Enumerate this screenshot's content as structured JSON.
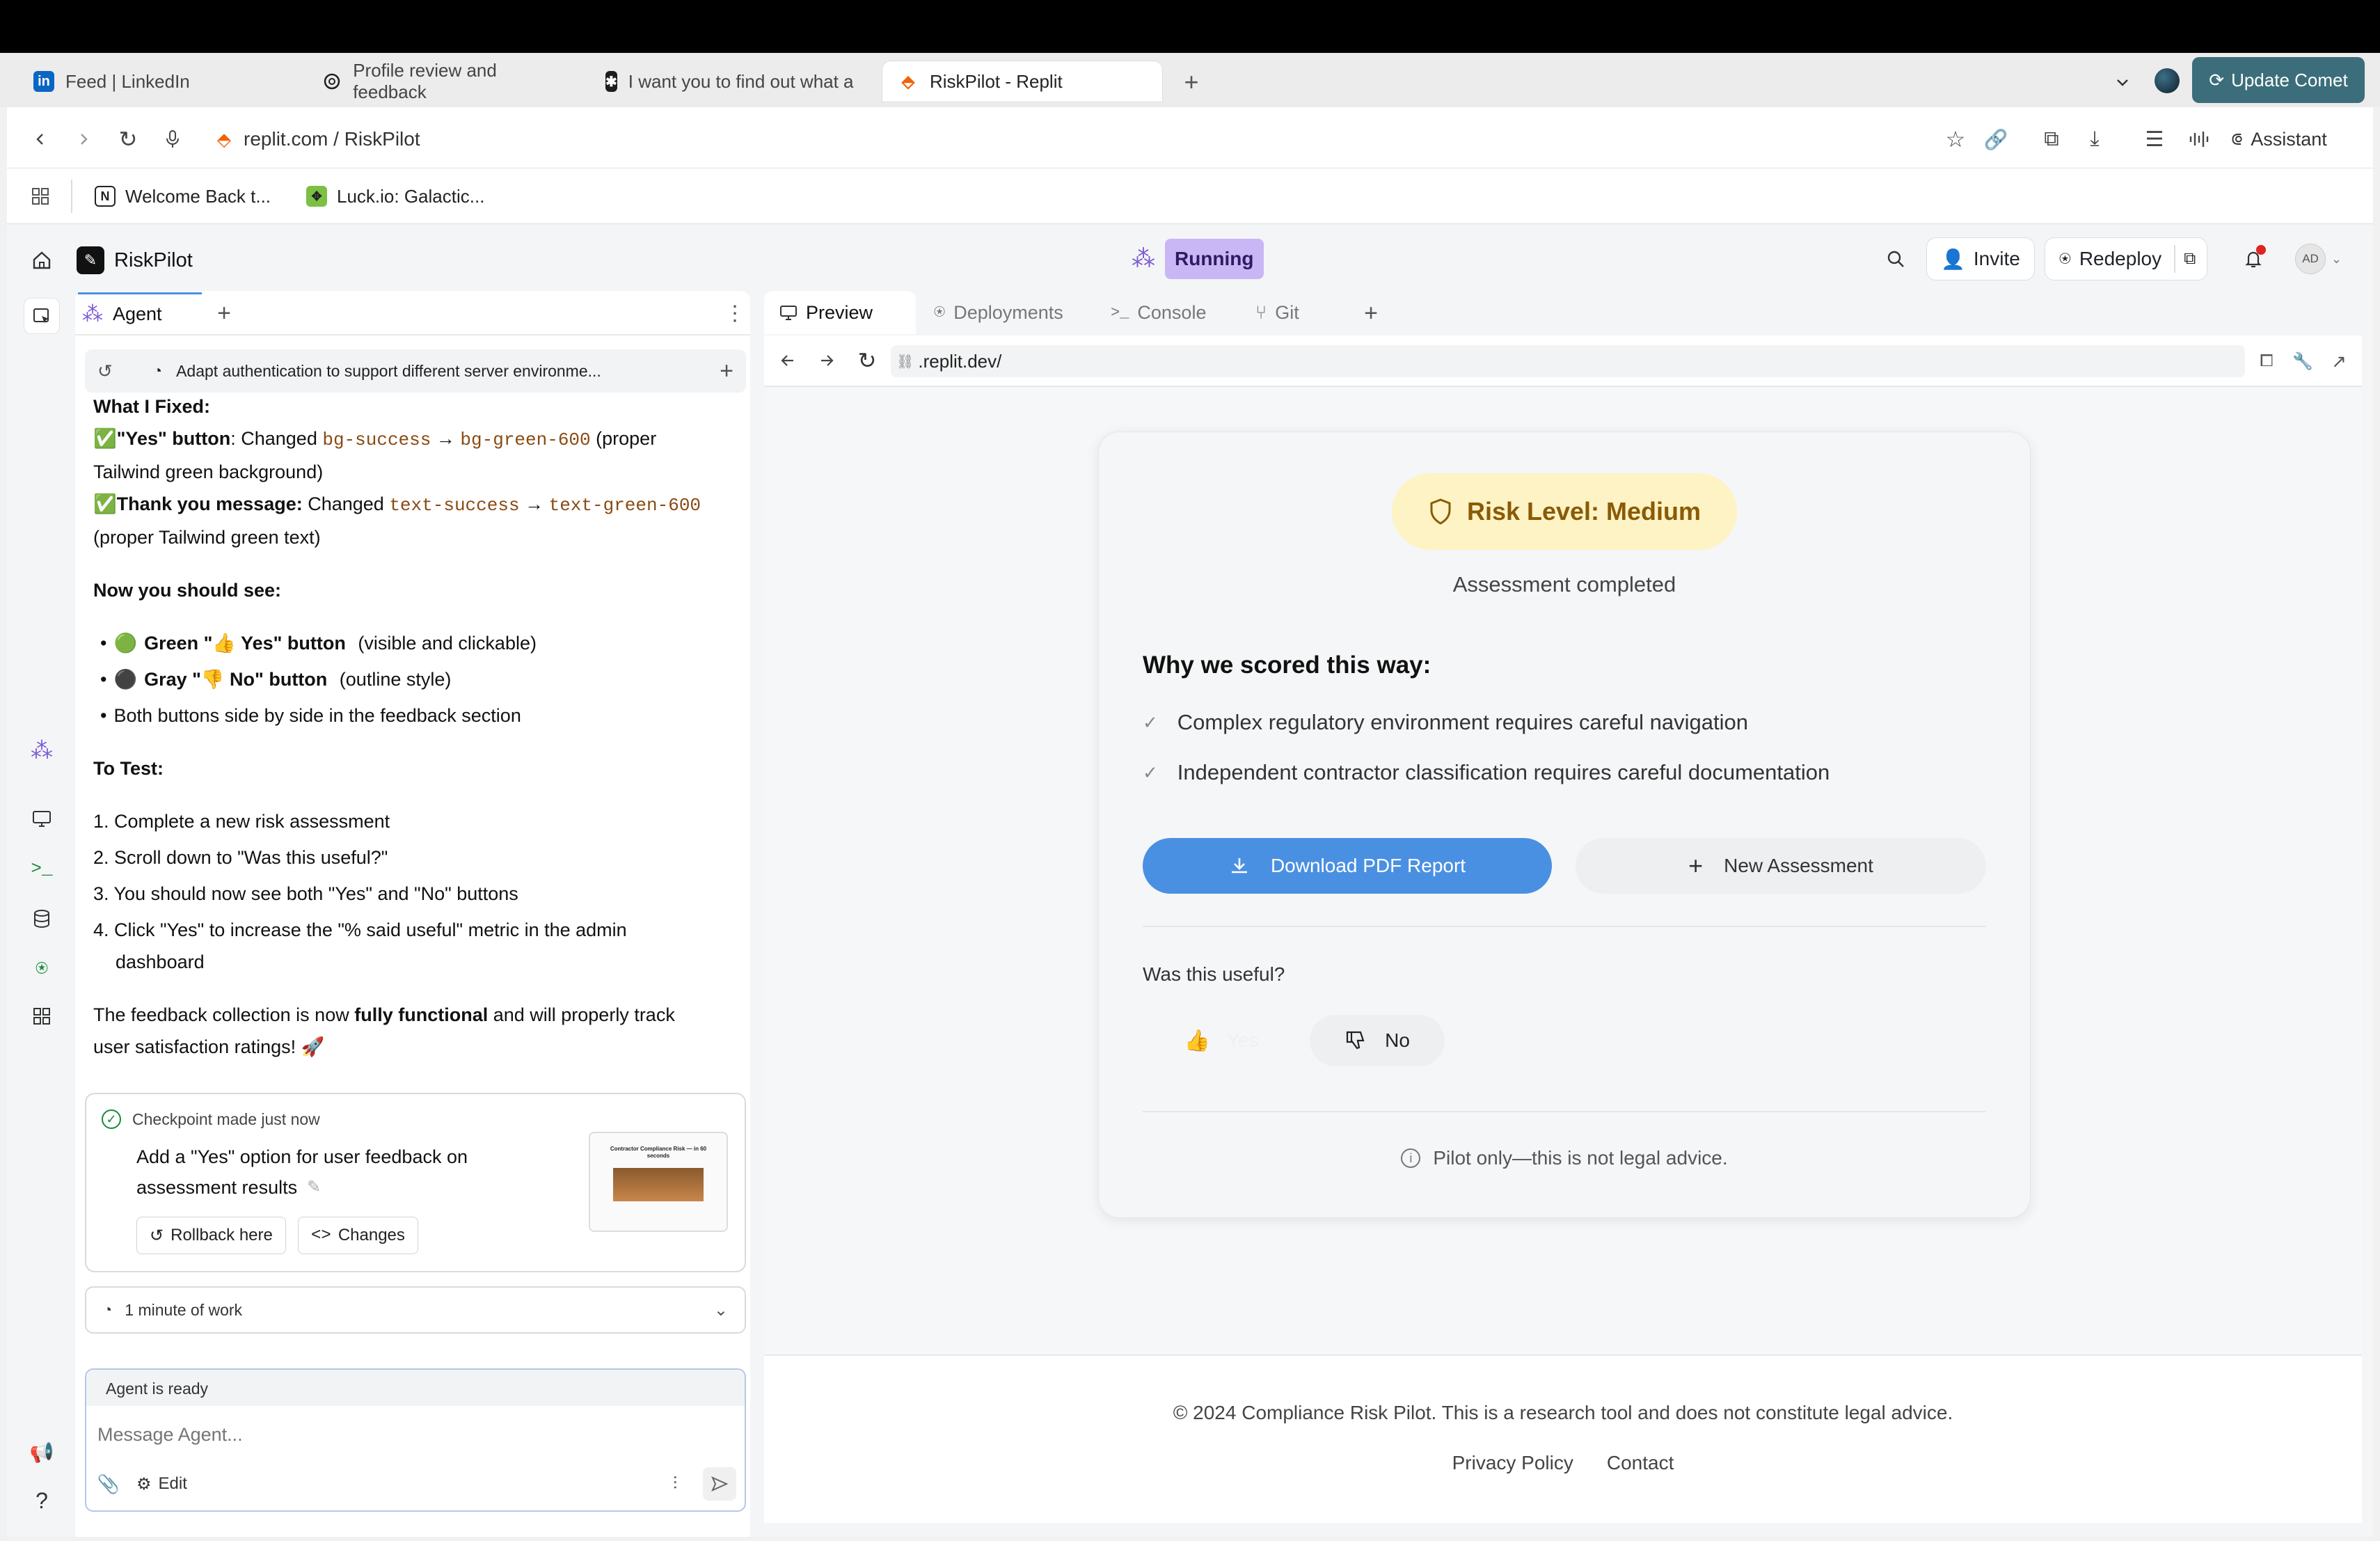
{
  "browser": {
    "tabs": [
      {
        "label": "Feed | LinkedIn",
        "icon": "linkedin-icon"
      },
      {
        "label": "Profile review and feedback",
        "icon": "openai-icon"
      },
      {
        "label": "I want you to find out what a",
        "icon": "perplexity-icon"
      },
      {
        "label": "RiskPilot - Replit",
        "icon": "replit-icon"
      }
    ],
    "update_button": "Update Comet",
    "address": "replit.com / RiskPilot",
    "assistant_label": "Assistant",
    "bookmarks": [
      "Welcome Back t...",
      "Luck.io: Galactic..."
    ]
  },
  "app": {
    "project_name": "RiskPilot",
    "status": "Running",
    "invite_label": "Invite",
    "redeploy_label": "Redeploy",
    "avatar_initials": "AD"
  },
  "agent_panel": {
    "tab_label": "Agent",
    "thread_title": "Adapt authentication to support different server environme...",
    "what_fixed_heading": "What I Fixed:",
    "fix1": {
      "check": "✅",
      "bold": "\"Yes\" button",
      "text": ": Changed ",
      "from": "bg-success",
      "arrow": "→",
      "to": "bg-green-600",
      "tail_a": " (proper",
      "tail_b": "Tailwind green background)"
    },
    "fix2": {
      "check": "✅",
      "bold": "Thank you message:",
      "text": " Changed ",
      "from": "text-success",
      "arrow": "→",
      "to": "text-green-600",
      "tail": "(proper Tailwind green text)"
    },
    "now_heading": "Now you should see:",
    "bullets": [
      {
        "emoji": "🟢",
        "bold": "Green \"👍 Yes\" button",
        "text": " (visible and clickable)"
      },
      {
        "emoji": "⚫",
        "bold": "Gray \"👎 No\" button",
        "text": " (outline style)"
      },
      {
        "emoji": "",
        "bold": "",
        "text": "Both buttons side by side in the feedback section"
      }
    ],
    "test_heading": "To Test:",
    "steps": [
      "1. Complete a new risk assessment",
      "2. Scroll down to \"Was this useful?\"",
      "3. You should now see both \"Yes\" and \"No\" buttons",
      "4. Click \"Yes\" to increase the \"% said useful\" metric in the admin"
    ],
    "step4_cont": "dashboard",
    "closing_a": "The feedback collection is now ",
    "closing_bold": "fully functional",
    "closing_b": " and will properly track",
    "closing_c": "user satisfaction ratings! 🚀",
    "checkpoint": {
      "label": "Checkpoint made just now",
      "title_a": "Add a \"Yes\" option for user feedback on",
      "title_b": "assessment results",
      "rollback": "Rollback here",
      "changes": "Changes",
      "thumb_title": "Contractor Compliance Risk — in 60 seconds"
    },
    "work_time": "1 minute of work",
    "agent_status": "Agent is ready",
    "input_placeholder": "Message Agent...",
    "edit_label": "Edit"
  },
  "preview_panel": {
    "tabs": [
      "Preview",
      "Deployments",
      "Console",
      "Git"
    ],
    "url": ".replit.dev/",
    "risk_badge": "Risk Level: Medium",
    "assessment_status": "Assessment completed",
    "why_heading": "Why we scored this way:",
    "reasons": [
      "Complex regulatory environment requires careful navigation",
      "Independent contractor classification requires careful documentation"
    ],
    "download_button": "Download PDF Report",
    "new_button": "New Assessment",
    "feedback_question": "Was this useful?",
    "yes_label": "Yes",
    "no_label": "No",
    "disclaimer": "Pilot only—this is not legal advice.",
    "footer_text": "© 2024 Compliance Risk Pilot. This is a research tool and does not constitute legal advice.",
    "footer_links": [
      "Privacy Policy",
      "Contact"
    ]
  },
  "colors": {
    "accent_blue": "#4a90e2",
    "badge_bg": "#fdf3c4",
    "badge_text": "#8a5a06",
    "running_bg": "#c9b6f5",
    "update_btn": "#3b6e7a"
  }
}
